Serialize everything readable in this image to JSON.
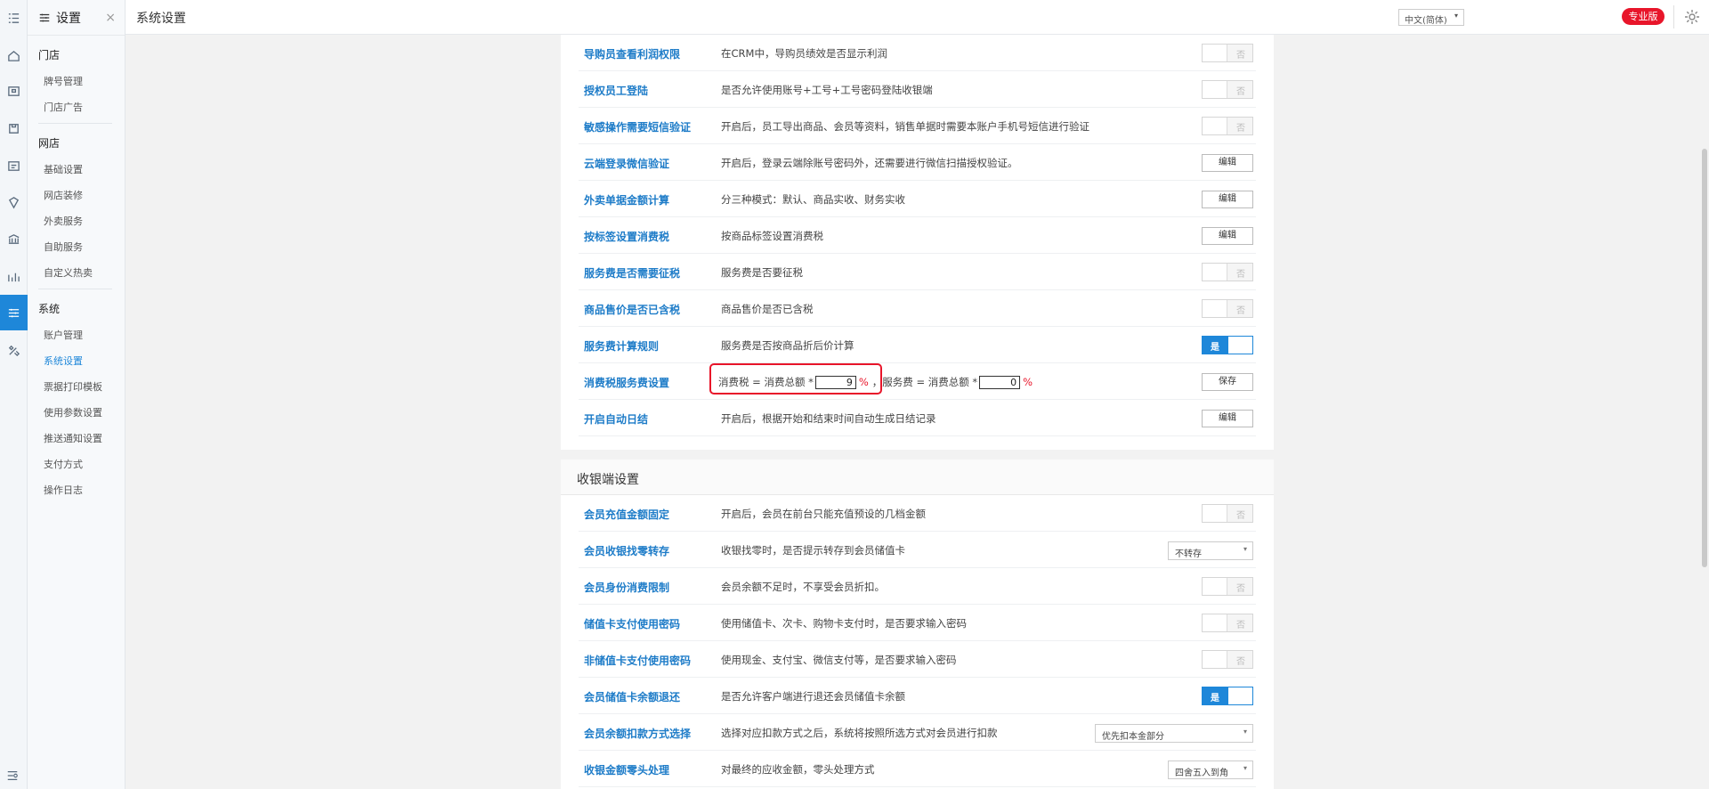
{
  "rail": {
    "icons": [
      "menu-icon",
      "home-icon",
      "store-icon",
      "shop-icon",
      "report-icon",
      "shield-icon",
      "bank-icon",
      "chart-icon",
      "settings-sliders-icon",
      "tools-icon"
    ],
    "active_index": 8
  },
  "subnav": {
    "title": "设置",
    "close": "×",
    "groups": [
      {
        "label": "门店",
        "items": [
          "牌号管理",
          "门店广告"
        ]
      },
      {
        "label": "网店",
        "items": [
          "基础设置",
          "网店装修",
          "外卖服务",
          "自助服务",
          "自定义热卖"
        ]
      },
      {
        "label": "系统",
        "items": [
          "账户管理",
          "系统设置",
          "票据打印模板",
          "使用参数设置",
          "推送通知设置",
          "支付方式",
          "操作日志"
        ]
      }
    ],
    "selected": "系统设置"
  },
  "topbar": {
    "title": "系统设置",
    "language": "中文(简体)",
    "edition_badge": "专业版"
  },
  "section1": {
    "rows": [
      {
        "label": "导购员查看利润权限",
        "desc": "在CRM中，导购员绩效是否显示利润",
        "control": "toggle",
        "value": "否"
      },
      {
        "label": "授权员工登陆",
        "desc": "是否允许使用账号+工号+工号密码登陆收银端",
        "control": "toggle",
        "value": "否"
      },
      {
        "label": "敏感操作需要短信验证",
        "desc": "开启后，员工导出商品、会员等资料，销售单据时需要本账户手机号短信进行验证",
        "control": "toggle",
        "value": "否"
      },
      {
        "label": "云端登录微信验证",
        "desc": "开启后，登录云端除账号密码外，还需要进行微信扫描授权验证。",
        "control": "button",
        "value": "编辑"
      },
      {
        "label": "外卖单据金额计算",
        "desc": "分三种模式：默认、商品实收、财务实收",
        "control": "button",
        "value": "编辑"
      },
      {
        "label": "按标签设置消费税",
        "desc": "按商品标签设置消费税",
        "control": "button",
        "value": "编辑"
      },
      {
        "label": "服务费是否需要征税",
        "desc": "服务费是否要征税",
        "control": "toggle",
        "value": "否"
      },
      {
        "label": "商品售价是否已含税",
        "desc": "商品售价是否已含税",
        "control": "toggle",
        "value": "否"
      },
      {
        "label": "服务费计算规则",
        "desc": "服务费是否按商品折后价计算",
        "control": "toggle-on",
        "value": "是"
      }
    ],
    "tax_row": {
      "label": "消费税服务费设置",
      "tax_prefix": "消费税 = 消费总额 *",
      "tax_value": "9",
      "pct": "%",
      "service_prefix": "，服务费 = 消费总额 *",
      "service_value": "0",
      "save": "保存"
    },
    "last_row": {
      "label": "开启自动日结",
      "desc": "开启后，根据开始和结束时间自动生成日结记录",
      "value": "编辑"
    }
  },
  "section2": {
    "title": "收银端设置",
    "rows": [
      {
        "label": "会员充值金额固定",
        "desc": "开启后，会员在前台只能充值预设的几档金额",
        "control": "toggle",
        "value": "否"
      },
      {
        "label": "会员收银找零转存",
        "desc": "收银找零时，是否提示转存到会员储值卡",
        "control": "select",
        "value": "不转存",
        "width": 96
      },
      {
        "label": "会员身份消费限制",
        "desc": "会员余额不足时，不享受会员折扣。",
        "control": "toggle",
        "value": "否"
      },
      {
        "label": "储值卡支付使用密码",
        "desc": "使用储值卡、次卡、购物卡支付时，是否要求输入密码",
        "control": "toggle",
        "value": "否"
      },
      {
        "label": "非储值卡支付使用密码",
        "desc": "使用现金、支付宝、微信支付等，是否要求输入密码",
        "control": "toggle",
        "value": "否"
      },
      {
        "label": "会员储值卡余额退还",
        "desc": "是否允许客户端进行退还会员储值卡余额",
        "control": "toggle-on",
        "value": "是"
      },
      {
        "label": "会员余额扣款方式选择",
        "desc": "选择对应扣款方式之后，系统将按照所选方式对会员进行扣款",
        "control": "select",
        "value": "优先扣本金部分",
        "width": 178
      },
      {
        "label": "收银金额零头处理",
        "desc": "对最终的应收金额，零头处理方式",
        "control": "select",
        "value": "四舍五入到角",
        "width": 96
      }
    ]
  }
}
